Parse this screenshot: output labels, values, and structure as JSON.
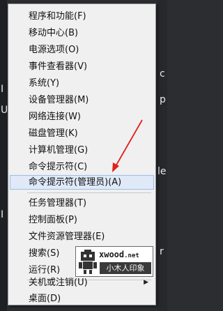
{
  "background": {
    "left_chars": [
      "I",
      "U",
      "I"
    ],
    "right_chars": [
      "c",
      "p",
      "le",
      "r"
    ]
  },
  "menu": {
    "items": [
      {
        "label": "程序和功能(F)"
      },
      {
        "label": "移动中心(B)"
      },
      {
        "label": "电源选项(O)"
      },
      {
        "label": "事件查看器(V)"
      },
      {
        "label": "系统(Y)"
      },
      {
        "label": "设备管理器(M)"
      },
      {
        "label": "网络连接(W)"
      },
      {
        "label": "磁盘管理(K)"
      },
      {
        "label": "计算机管理(G)"
      },
      {
        "label": "命令提示符(C)"
      },
      {
        "label": "命令提示符(管理员)(A)",
        "highlighted": true
      },
      {
        "label": "任务管理器(T)"
      },
      {
        "label": "控制面板(P)"
      },
      {
        "label": "文件资源管理器(E)"
      },
      {
        "label": "搜索(S)"
      },
      {
        "label": "运行(R)"
      },
      {
        "label": "关机或注销(U)",
        "submenu": true
      },
      {
        "label": "桌面(D)"
      }
    ],
    "submenu_arrow_icon": "triangle-right-icon"
  },
  "annotation": {
    "arrow_color": "#e0201c",
    "icon": "red-arrow-icon"
  },
  "watermark": {
    "brand": "xwood",
    "brand_suffix": ".net",
    "caption": "小木人印象",
    "icon": "robot-icon"
  }
}
